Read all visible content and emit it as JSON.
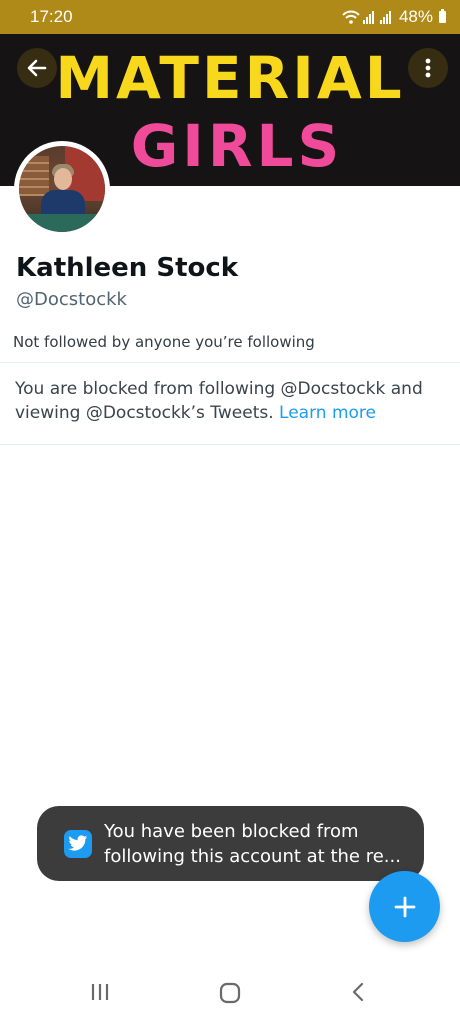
{
  "status_bar": {
    "time": "17:20",
    "battery": "48%",
    "icons": [
      "wifi-icon",
      "signal-icon",
      "signal-icon",
      "battery-icon"
    ]
  },
  "banner": {
    "line1": "MATERIAL",
    "line2": "GIRLS",
    "colors": {
      "line1": "#f8d81c",
      "line2": "#f04a9a",
      "background": "#151313"
    }
  },
  "profile": {
    "name": "Kathleen Stock",
    "handle": "@Docstockk",
    "followed_note": "Not followed by anyone you’re following"
  },
  "blocked_notice": {
    "text": "You are blocked from following @Docstockk and viewing @Docstockk’s Tweets.",
    "link_label": "Learn more"
  },
  "toast": {
    "line1": "You have been blocked from",
    "line2": "following this account at the re..."
  },
  "accent_color": "#1d9bf0",
  "nav_bar": {
    "items": [
      "recents-icon",
      "home-icon",
      "back-icon"
    ]
  }
}
